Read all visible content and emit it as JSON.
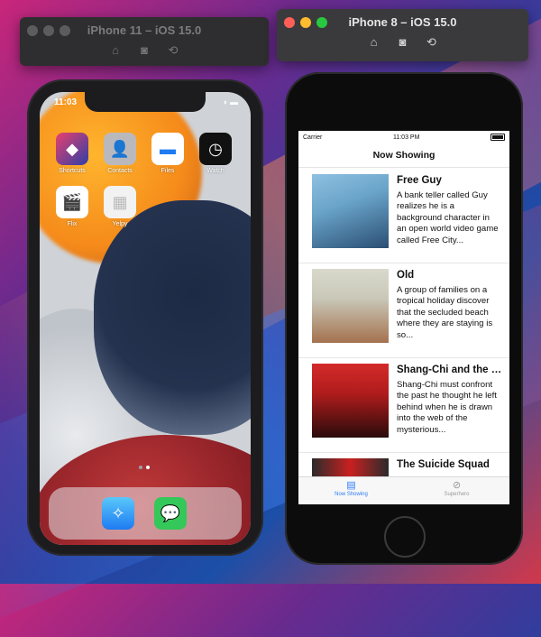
{
  "simulators": {
    "left": {
      "title": "iPhone 11 – iOS 15.0"
    },
    "right": {
      "title": "iPhone 8 – iOS 15.0"
    }
  },
  "toolbar_icons": [
    "home-icon",
    "screenshot-icon",
    "rotate-icon"
  ],
  "iphone11": {
    "time": "11:03",
    "apps": [
      {
        "label": "Shortcuts",
        "icon": "shortcuts-icon",
        "color": "#2f3fa8"
      },
      {
        "label": "Contacts",
        "icon": "contacts-icon",
        "color": "#b9b9bd"
      },
      {
        "label": "Files",
        "icon": "files-icon",
        "color": "#ffffff"
      },
      {
        "label": "Watch",
        "icon": "watch-icon",
        "color": "#1a1a1a"
      },
      {
        "label": "Flix",
        "icon": "clapper-icon",
        "color": "#ffffff"
      },
      {
        "label": "Yelpy",
        "icon": "yelpy-icon",
        "color": "#f2f2f2"
      }
    ],
    "dock_apps": [
      "safari-icon",
      "messages-icon"
    ]
  },
  "iphone8": {
    "carrier": "Carrier",
    "time": "11:03 PM",
    "nav_title": "Now Showing",
    "movies": [
      {
        "title": "Free Guy",
        "description": "A bank teller called Guy realizes he is a background character in an open world video game called Free City...",
        "poster_colors": [
          "#6aa4c9",
          "#2b4e73"
        ]
      },
      {
        "title": "Old",
        "description": "A group of families on a tropical holiday discover that the secluded beach where they are staying is so...",
        "poster_colors": [
          "#c9c8b8",
          "#a4714e"
        ]
      },
      {
        "title": "Shang-Chi and the Legend of the Ten Rings",
        "description": "Shang-Chi must confront the past he thought he left behind when he is drawn into the web of the mysterious...",
        "poster_colors": [
          "#b01c1c",
          "#2a0b0b"
        ]
      },
      {
        "title": "The Suicide Squad",
        "description": "",
        "poster_colors": [
          "#2b2b2b",
          "#c92020"
        ]
      }
    ],
    "tabs": [
      {
        "label": "Now Showing",
        "icon": "film-icon",
        "active": true
      },
      {
        "label": "Superhero",
        "icon": "compass-icon",
        "active": false
      }
    ]
  }
}
